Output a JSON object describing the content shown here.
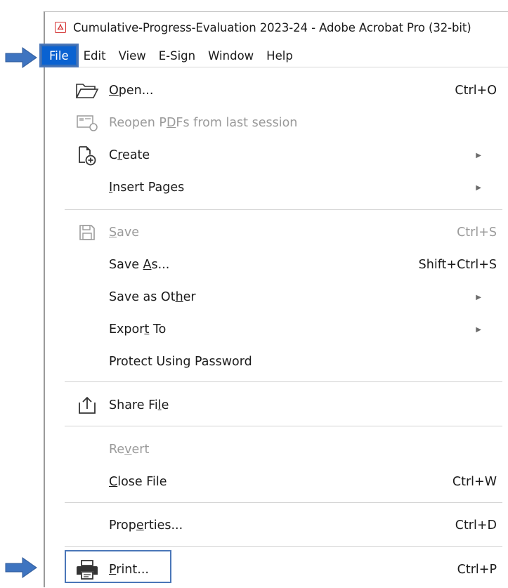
{
  "window": {
    "title": "Cumulative-Progress-Evaluation 2023-24 - Adobe Acrobat Pro (32-bit)",
    "app_icon": "adobe-acrobat-icon"
  },
  "menubar": {
    "items": [
      {
        "label": "File",
        "active": true
      },
      {
        "label": "Edit"
      },
      {
        "label": "View"
      },
      {
        "label": "E-Sign"
      },
      {
        "label": "Window"
      },
      {
        "label": "Help"
      }
    ]
  },
  "file_menu": {
    "items": [
      {
        "key": "open",
        "pre": "",
        "u": "O",
        "post": "pen...",
        "shortcut": "Ctrl+O",
        "icon": "folder-open-icon"
      },
      {
        "key": "reopen",
        "pre": "Reopen P",
        "u": "D",
        "post": "Fs from last session",
        "shortcut": "",
        "icon": "reopen-pdfs-icon",
        "disabled": true
      },
      {
        "key": "create",
        "pre": "C",
        "u": "r",
        "post": "eate",
        "submenu": true,
        "icon": "create-pdf-icon"
      },
      {
        "key": "insert",
        "pre": "",
        "u": "I",
        "post": "nsert Pages",
        "submenu": true
      },
      {
        "key": "save",
        "pre": "",
        "u": "S",
        "post": "ave",
        "shortcut": "Ctrl+S",
        "icon": "save-icon",
        "disabled": true
      },
      {
        "key": "saveas",
        "pre": "Save ",
        "u": "A",
        "post": "s...",
        "shortcut": "Shift+Ctrl+S"
      },
      {
        "key": "saveother",
        "pre": "Save as Ot",
        "u": "h",
        "post": "er",
        "submenu": true
      },
      {
        "key": "export",
        "pre": "Expor",
        "u": "t",
        "post": " To",
        "submenu": true
      },
      {
        "key": "protect",
        "pre": "Protect Using Password",
        "u": "",
        "post": ""
      },
      {
        "key": "share",
        "pre": "Share Fi",
        "u": "l",
        "post": "e",
        "icon": "share-icon"
      },
      {
        "key": "revert",
        "pre": "Re",
        "u": "v",
        "post": "ert",
        "disabled": true
      },
      {
        "key": "close",
        "pre": "",
        "u": "C",
        "post": "lose File",
        "shortcut": "Ctrl+W"
      },
      {
        "key": "properties",
        "pre": "Prop",
        "u": "e",
        "post": "rties...",
        "shortcut": "Ctrl+D"
      },
      {
        "key": "print",
        "pre": "",
        "u": "P",
        "post": "rint...",
        "shortcut": "Ctrl+P",
        "icon": "printer-icon"
      }
    ]
  },
  "colors": {
    "accent": "#0a62d1",
    "highlight_border": "#4a76b8",
    "disabled_text": "#9a9a9a"
  }
}
